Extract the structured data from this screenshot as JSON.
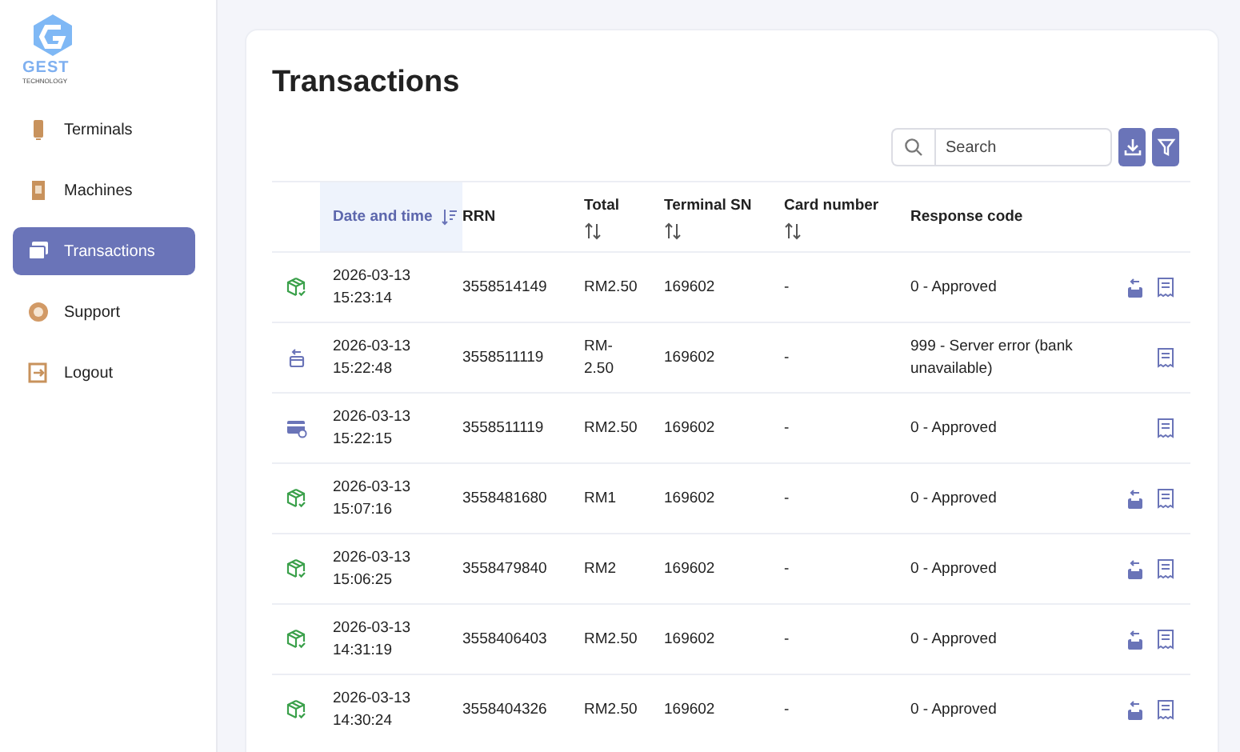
{
  "brand": {
    "name": "GEST",
    "tagline": "TECHNOLOGY"
  },
  "sidebar": {
    "items": [
      {
        "label": "Terminals",
        "selected": false
      },
      {
        "label": "Machines",
        "selected": false
      },
      {
        "label": "Transactions",
        "selected": true
      },
      {
        "label": "Support",
        "selected": false
      },
      {
        "label": "Logout",
        "selected": false
      }
    ]
  },
  "page": {
    "title": "Transactions"
  },
  "search": {
    "placeholder": "Search"
  },
  "table": {
    "columns": [
      {
        "label": "Date and time",
        "sortable": true,
        "sorted": true
      },
      {
        "label": "RRN",
        "sortable": false,
        "sorted": false
      },
      {
        "label": "Total",
        "sortable": true,
        "sorted": false
      },
      {
        "label": "Terminal SN",
        "sortable": true,
        "sorted": false
      },
      {
        "label": "Card number",
        "sortable": true,
        "sorted": false
      },
      {
        "label": "Response code",
        "sortable": false,
        "sorted": false
      }
    ],
    "rows": [
      {
        "kind": "sale",
        "date": "2026-03-13",
        "time": "15:23:14",
        "rrn": "3558514149",
        "total": "RM2.50",
        "terminal_sn": "169602",
        "card_number": "-",
        "response": "0 - Approved",
        "refundable": true
      },
      {
        "kind": "refund",
        "date": "2026-03-13",
        "time": "15:22:48",
        "rrn": "3558511119",
        "total": "RM-2.50",
        "terminal_sn": "169602",
        "card_number": "-",
        "response": "999 - Server error (bank unavailable)",
        "refundable": false
      },
      {
        "kind": "card",
        "date": "2026-03-13",
        "time": "15:22:15",
        "rrn": "3558511119",
        "total": "RM2.50",
        "terminal_sn": "169602",
        "card_number": "-",
        "response": "0 - Approved",
        "refundable": false
      },
      {
        "kind": "sale",
        "date": "2026-03-13",
        "time": "15:07:16",
        "rrn": "3558481680",
        "total": "RM1",
        "terminal_sn": "169602",
        "card_number": "-",
        "response": "0 - Approved",
        "refundable": true
      },
      {
        "kind": "sale",
        "date": "2026-03-13",
        "time": "15:06:25",
        "rrn": "3558479840",
        "total": "RM2",
        "terminal_sn": "169602",
        "card_number": "-",
        "response": "0 - Approved",
        "refundable": true
      },
      {
        "kind": "sale",
        "date": "2026-03-13",
        "time": "14:31:19",
        "rrn": "3558406403",
        "total": "RM2.50",
        "terminal_sn": "169602",
        "card_number": "-",
        "response": "0 - Approved",
        "refundable": true
      },
      {
        "kind": "sale",
        "date": "2026-03-13",
        "time": "14:30:24",
        "rrn": "3558404326",
        "total": "RM2.50",
        "terminal_sn": "169602",
        "card_number": "-",
        "response": "0 - Approved",
        "refundable": true
      }
    ]
  }
}
